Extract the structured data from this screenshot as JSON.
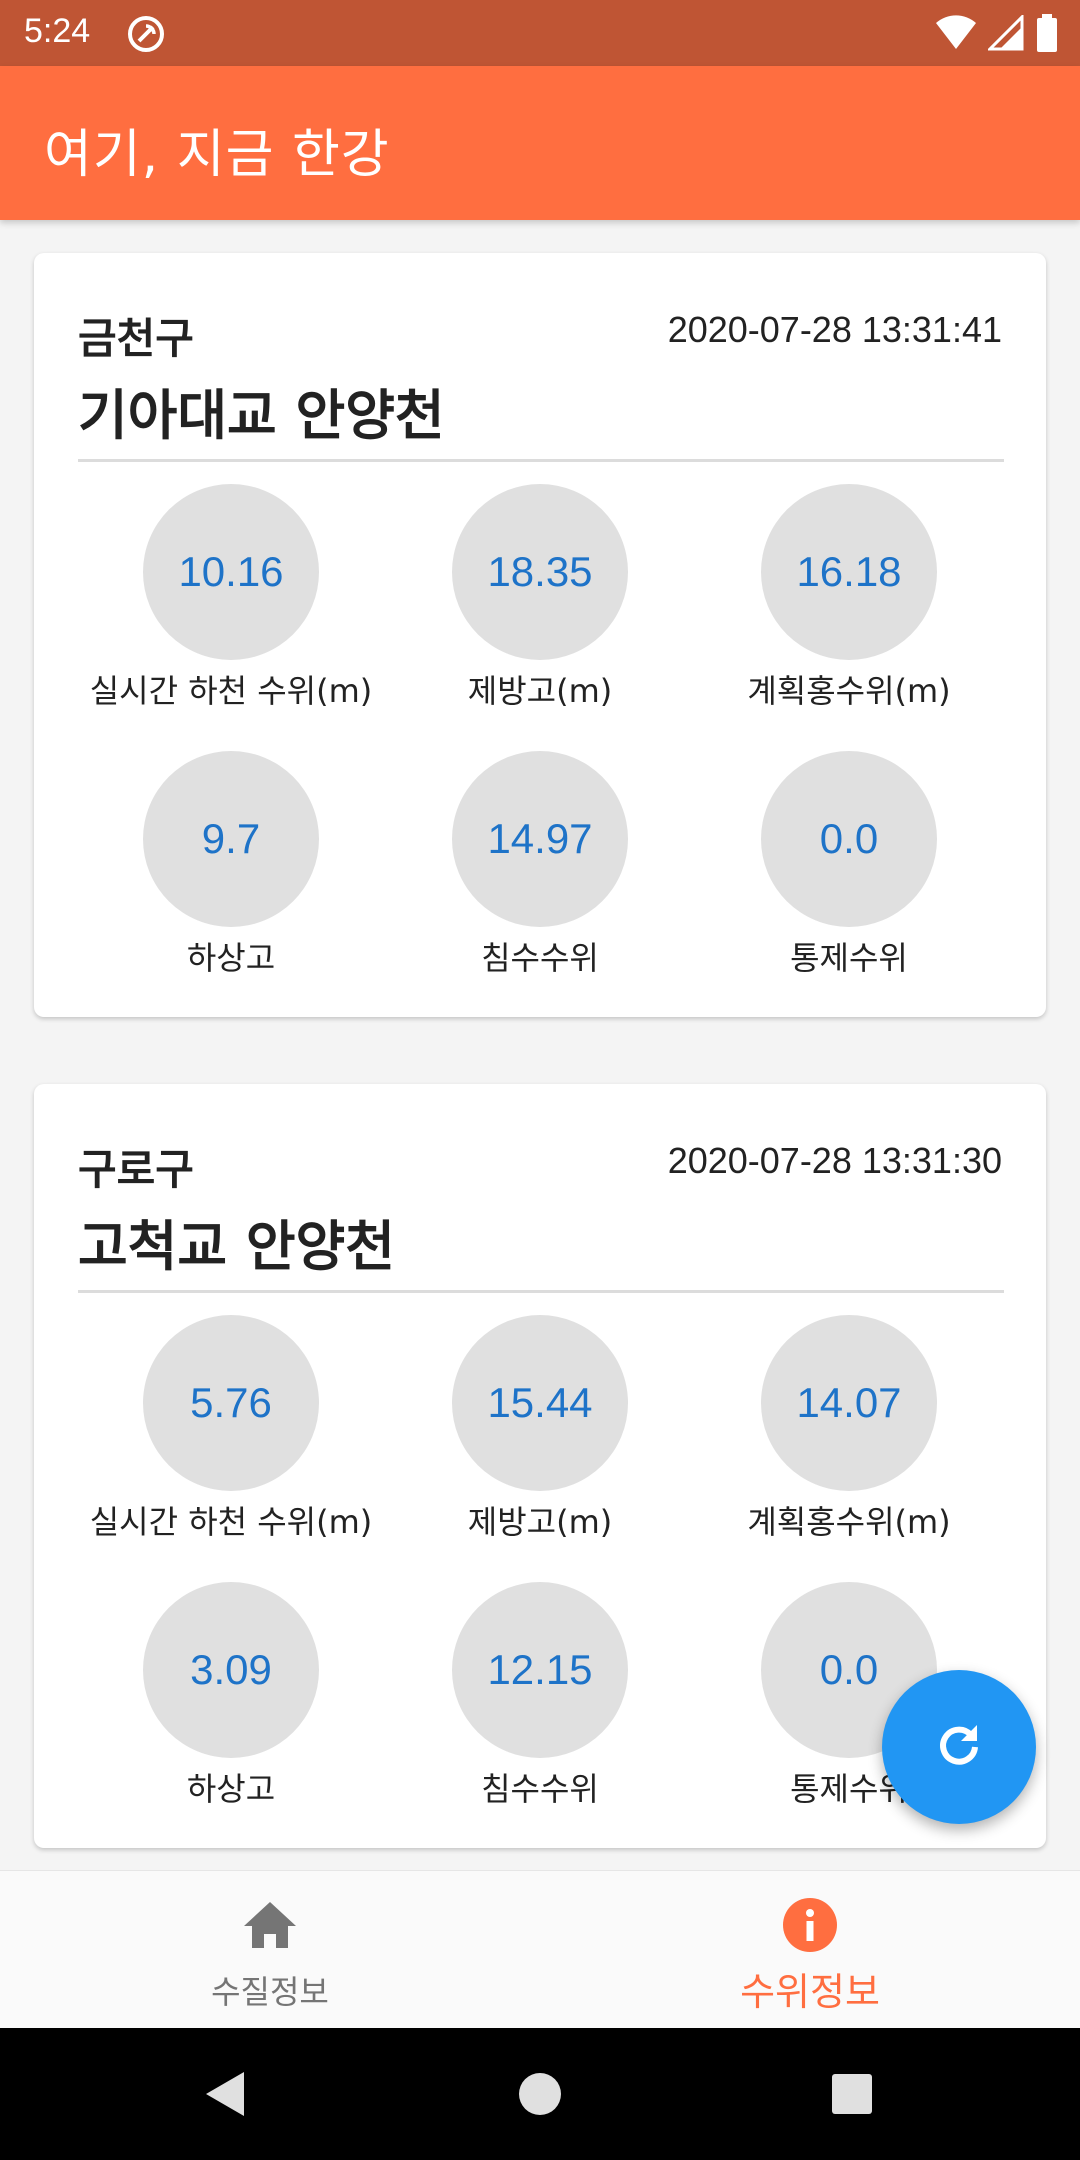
{
  "status_bar": {
    "time": "5:24",
    "icons": [
      "no-disturb-icon",
      "wifi-icon",
      "signal-icon",
      "battery-icon"
    ]
  },
  "app_bar": {
    "title": "여기, 지금 한강"
  },
  "stations": [
    {
      "district": "금천구",
      "timestamp": "2020-07-28 13:31:41",
      "name": "기아대교 안양천",
      "metrics": [
        {
          "value": "10.16",
          "label": "실시간 하천 수위(m)"
        },
        {
          "value": "18.35",
          "label": "제방고(m)"
        },
        {
          "value": "16.18",
          "label": "계획홍수위(m)"
        },
        {
          "value": "9.7",
          "label": "하상고"
        },
        {
          "value": "14.97",
          "label": "침수수위"
        },
        {
          "value": "0.0",
          "label": "통제수위"
        }
      ]
    },
    {
      "district": "구로구",
      "timestamp": "2020-07-28 13:31:30",
      "name": "고척교 안양천",
      "metrics": [
        {
          "value": "5.76",
          "label": "실시간 하천 수위(m)"
        },
        {
          "value": "15.44",
          "label": "제방고(m)"
        },
        {
          "value": "14.07",
          "label": "계획홍수위(m)"
        },
        {
          "value": "3.09",
          "label": "하상고"
        },
        {
          "value": "12.15",
          "label": "침수수위"
        },
        {
          "value": "0.0",
          "label": "통제수위"
        }
      ]
    }
  ],
  "fab": {
    "icon": "refresh-icon"
  },
  "bottom_nav": {
    "items": [
      {
        "label": "수질정보",
        "icon": "home-icon",
        "active": false
      },
      {
        "label": "수위정보",
        "icon": "info-icon",
        "active": true
      }
    ]
  },
  "colors": {
    "status_bar": "#bf5534",
    "app_bar": "#ff6e40",
    "value_text": "#1e73c8",
    "fab": "#2196f3",
    "active_nav": "#ff6e40"
  }
}
